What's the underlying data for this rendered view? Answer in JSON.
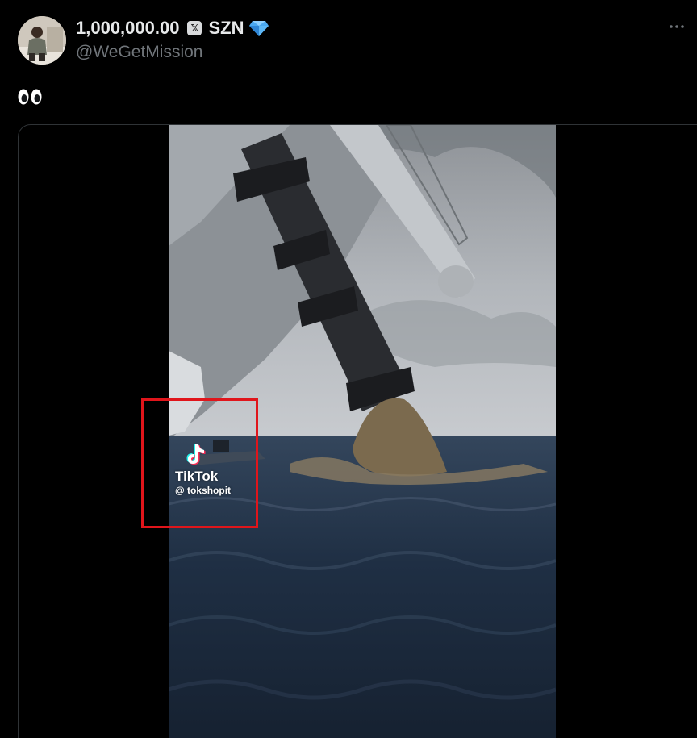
{
  "author": {
    "display_name": "1,000,000.00",
    "badge_glyph": "𝕏",
    "name_suffix": "SZN",
    "handle": "@WeGetMission",
    "avatar_icon": "person-avatar"
  },
  "tweet": {
    "text_icons": [
      "eyes-emoji"
    ]
  },
  "media": {
    "watermark": {
      "brand": "TikTok",
      "handle": "@ tokshopit"
    },
    "highlight_color": "#e0151b"
  },
  "colors": {
    "background": "#000000",
    "text_primary": "#e7e9ea",
    "text_secondary": "#71767b",
    "card_border": "#2f3336"
  }
}
